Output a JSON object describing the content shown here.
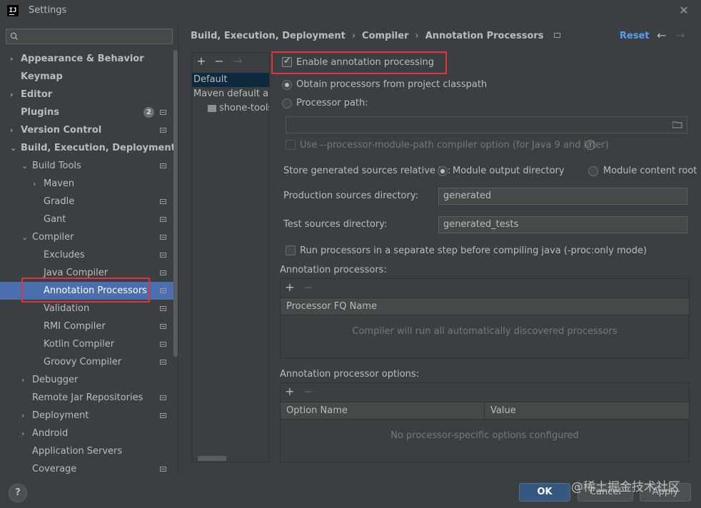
{
  "window": {
    "logo": "IJ",
    "title": "Settings",
    "close_icon": "close-icon"
  },
  "search": {
    "placeholder": ""
  },
  "sidebar": {
    "items": [
      {
        "label": "Appearance & Behavior",
        "arrow": "›",
        "bold": true
      },
      {
        "label": "Keymap",
        "bold": true
      },
      {
        "label": "Editor",
        "arrow": "›",
        "bold": true
      },
      {
        "label": "Plugins",
        "bold": true,
        "badge": "2"
      },
      {
        "label": "Version Control",
        "arrow": "›",
        "bold": true
      },
      {
        "label": "Build, Execution, Deployment",
        "arrow": "⌄",
        "bold": true
      },
      {
        "label": "Build Tools",
        "arrow": "⌄"
      },
      {
        "label": "Maven",
        "arrow": "›"
      },
      {
        "label": "Gradle"
      },
      {
        "label": "Gant"
      },
      {
        "label": "Compiler",
        "arrow": "⌄"
      },
      {
        "label": "Excludes"
      },
      {
        "label": "Java Compiler"
      },
      {
        "label": "Annotation Processors",
        "selected": true
      },
      {
        "label": "Validation"
      },
      {
        "label": "RMI Compiler"
      },
      {
        "label": "Kotlin Compiler"
      },
      {
        "label": "Groovy Compiler"
      },
      {
        "label": "Debugger",
        "arrow": "›"
      },
      {
        "label": "Remote Jar Repositories"
      },
      {
        "label": "Deployment",
        "arrow": "›"
      },
      {
        "label": "Android",
        "arrow": "›"
      },
      {
        "label": "Application Servers"
      },
      {
        "label": "Coverage"
      }
    ]
  },
  "header": {
    "breadcrumb": [
      "Build, Execution, Deployment",
      "Compiler",
      "Annotation Processors"
    ],
    "separator": "›",
    "reset_label": "Reset",
    "back_icon": "←",
    "forward_icon": "→"
  },
  "profiles": {
    "add": "+",
    "remove": "−",
    "move": "→",
    "items": [
      "Default",
      "Maven default annotation processors profile",
      "shone-tools"
    ]
  },
  "settings": {
    "enable_annotation_processing": {
      "label": "Enable annotation processing",
      "checked": true
    },
    "obtain_from_classpath": {
      "label": "Obtain processors from project classpath",
      "selected": true
    },
    "processor_path": {
      "label": "Processor path:",
      "selected": false,
      "value": ""
    },
    "processor_module_path": {
      "label": "Use --processor-module-path compiler option (for Java 9 and later)",
      "checked": false,
      "help": "?"
    },
    "store_generated_label": "Store generated sources relative to:",
    "module_output_dir": {
      "label": "Module output directory",
      "selected": true
    },
    "module_content_root": {
      "label": "Module content root",
      "selected": false
    },
    "production_sources": {
      "label": "Production sources directory:",
      "value": "generated"
    },
    "test_sources": {
      "label": "Test sources directory:",
      "value": "generated_tests"
    },
    "separate_step": {
      "label": "Run processors in a separate step before compiling java (-proc:only mode)",
      "checked": false
    }
  },
  "annotation_processors": {
    "title": "Annotation processors:",
    "add": "+",
    "remove": "−",
    "column": "Processor FQ Name",
    "empty": "Compiler will run all automatically discovered processors"
  },
  "annotation_processor_options": {
    "title": "Annotation processor options:",
    "add": "+",
    "remove": "−",
    "columns": [
      "Option Name",
      "Value"
    ],
    "empty": "No processor-specific options configured"
  },
  "footer": {
    "help": "?",
    "ok": "OK",
    "cancel": "Cancel",
    "apply": "Apply"
  },
  "watermark": "@稀土掘金技术社区",
  "colors": {
    "accent": "#4b6eaf",
    "link": "#589df6",
    "highlight_box": "#e0333e",
    "ok_button": "#365880"
  }
}
